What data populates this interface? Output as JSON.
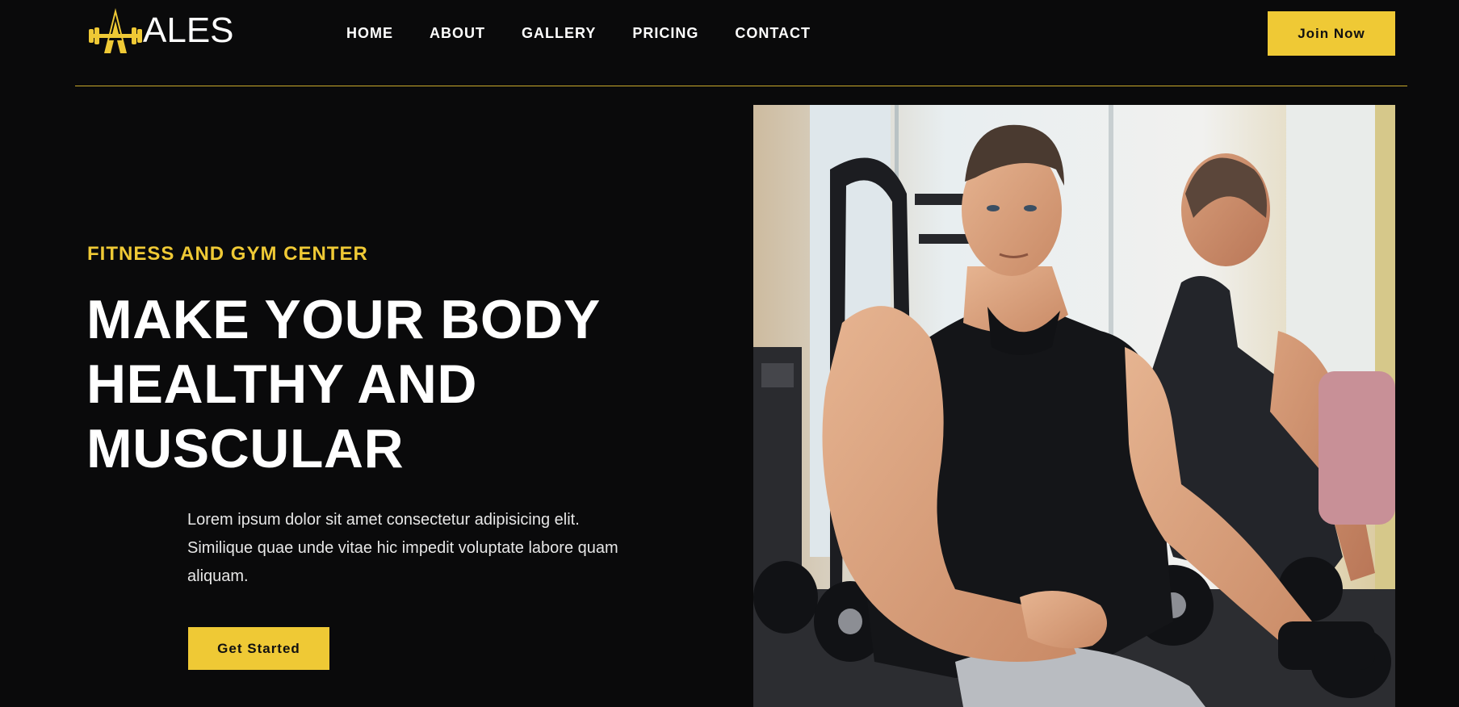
{
  "brand": {
    "logo_text": "ALES",
    "accent_color": "#efc935"
  },
  "nav": {
    "items": [
      {
        "label": "HOME"
      },
      {
        "label": "ABOUT"
      },
      {
        "label": "GALLERY"
      },
      {
        "label": "PRICING"
      },
      {
        "label": "CONTACT"
      }
    ]
  },
  "header": {
    "join_label": "Join Now"
  },
  "hero": {
    "eyebrow": "FITNESS AND GYM CENTER",
    "headline_lines": [
      "MAKE YOUR BODY",
      "HEALTHY AND",
      "MUSCULAR"
    ],
    "description": "Lorem ipsum dolor sit amet consectetur adipisicing elit. Similique quae unde vitae hic impedit voluptate labore quam aliquam.",
    "cta_label": "Get Started",
    "image_subject": "muscular man in black tank top sitting by dumbbell rack in gym"
  }
}
